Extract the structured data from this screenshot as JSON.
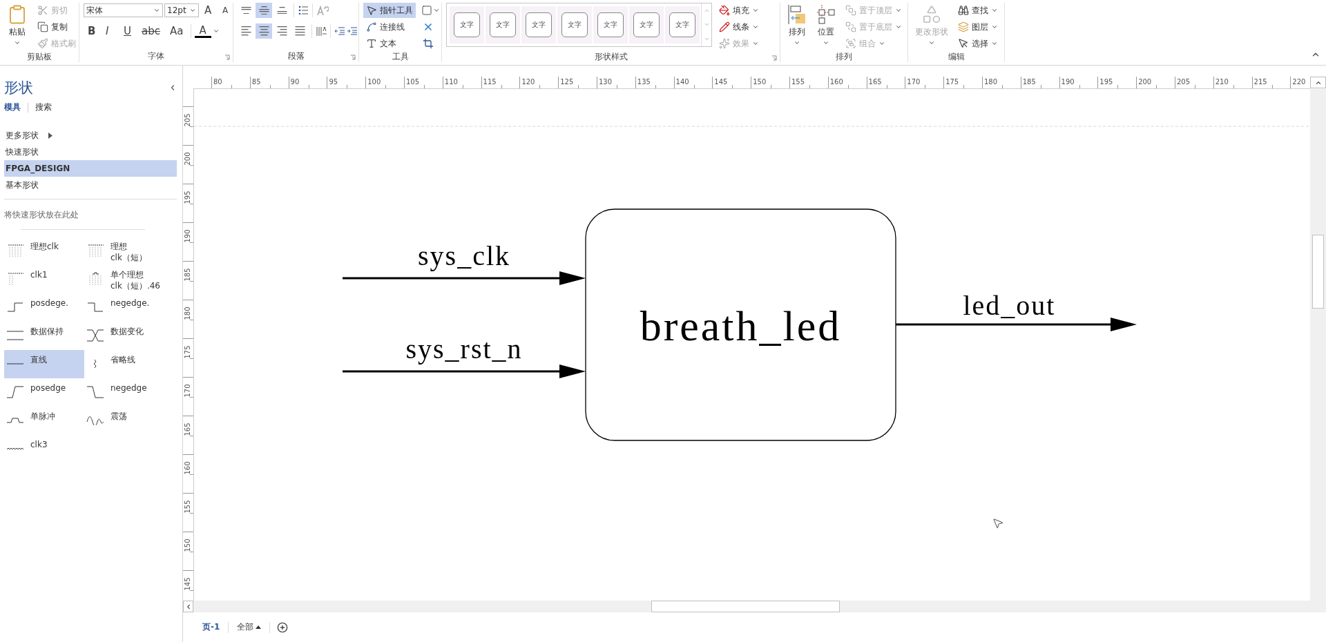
{
  "ribbon": {
    "groups": [
      {
        "kind": "clipboard",
        "label": "剪贴板",
        "paste": {
          "label": "粘贴"
        },
        "actions": [
          {
            "label": "剪切",
            "kind": "cut",
            "disabled": true
          },
          {
            "label": "复制",
            "kind": "copy",
            "disabled": false
          },
          {
            "label": "格式刷",
            "kind": "painter",
            "disabled": true
          }
        ]
      },
      {
        "kind": "font",
        "label": "字体",
        "launcher": true,
        "font_name": "宋体",
        "font_size": "12pt",
        "size_buttons": [
          {
            "text": "A",
            "kind": "grow"
          },
          {
            "text": "A",
            "kind": "shrink"
          }
        ],
        "format_buttons": [
          {
            "text": "B",
            "kind": "bold"
          },
          {
            "text": "I",
            "kind": "italic"
          },
          {
            "text": "U",
            "kind": "underline"
          },
          {
            "text": "abc",
            "kind": "strike"
          },
          {
            "text": "Aa",
            "kind": "case"
          }
        ],
        "font_color": {
          "text": "A"
        }
      },
      {
        "kind": "paragraph",
        "label": "段落",
        "launcher": true,
        "vertical_align": [
          {
            "kind": "top",
            "selected": false
          },
          {
            "kind": "middle",
            "selected": true
          },
          {
            "kind": "bottom",
            "selected": false
          }
        ],
        "horizontal_align": [
          {
            "kind": "left",
            "selected": false
          },
          {
            "kind": "center",
            "selected": true
          },
          {
            "kind": "right",
            "selected": false
          },
          {
            "kind": "justify",
            "selected": false
          }
        ]
      },
      {
        "kind": "tools",
        "label": "工具",
        "tools": [
          {
            "label": "指针工具",
            "kind": "pointer",
            "selected": true
          },
          {
            "label": "连接线",
            "kind": "connector",
            "selected": false
          },
          {
            "label": "文本",
            "kind": "text",
            "selected": false
          }
        ]
      },
      {
        "kind": "styles",
        "label": "形状样式",
        "launcher": true,
        "gallery": [
          "文字",
          "文字",
          "文字",
          "文字",
          "文字",
          "文字",
          "文字"
        ],
        "actions": [
          {
            "label": "填充",
            "kind": "fill",
            "disabled": false
          },
          {
            "label": "线条",
            "kind": "line",
            "disabled": false
          },
          {
            "label": "效果",
            "kind": "effects",
            "disabled": true
          }
        ]
      },
      {
        "kind": "arrange",
        "label": "排列",
        "big": [
          {
            "label": "排列",
            "kind": "arrange"
          },
          {
            "label": "位置",
            "kind": "position"
          }
        ],
        "actions": [
          {
            "label": "置于顶层",
            "kind": "front",
            "disabled": true
          },
          {
            "label": "置于底层",
            "kind": "back",
            "disabled": true
          },
          {
            "label": "组合",
            "kind": "group",
            "disabled": true
          }
        ]
      },
      {
        "kind": "edit",
        "label": "编辑",
        "big": {
          "label": "更改形状",
          "disabled": true
        },
        "actions": [
          {
            "label": "查找",
            "kind": "find",
            "disabled": false
          },
          {
            "label": "图层",
            "kind": "layers",
            "disabled": false
          },
          {
            "label": "选择",
            "kind": "select",
            "disabled": false
          }
        ]
      }
    ]
  },
  "sidebar": {
    "title": "形状",
    "tabs": [
      {
        "label": "模具",
        "selected": true
      },
      {
        "label": "搜索",
        "selected": false
      }
    ],
    "menu": [
      {
        "label": "更多形状",
        "kind": "submenu",
        "selected": false
      },
      {
        "label": "快速形状",
        "kind": "plain",
        "selected": false
      },
      {
        "label": "FPGA_DESIGN",
        "kind": "plain",
        "selected": true
      },
      {
        "label": "基本形状",
        "kind": "plain",
        "selected": false
      }
    ],
    "hint": "将快速形状放在此处",
    "stencils": [
      {
        "label": "理想clk",
        "kind": "clk-ideal",
        "selected": false
      },
      {
        "label": "理想\nclk（短）",
        "kind": "clk-short",
        "selected": false
      },
      {
        "label": "clk1",
        "kind": "clk1",
        "selected": false
      },
      {
        "label": "单个理想\nclk（短）.46",
        "kind": "clk-single",
        "selected": false
      },
      {
        "label": "posdege.",
        "kind": "step-up",
        "selected": false
      },
      {
        "label": "negedge.",
        "kind": "step-down",
        "selected": false
      },
      {
        "label": "数据保持",
        "kind": "hold",
        "selected": false
      },
      {
        "label": "数据变化",
        "kind": "change",
        "selected": false
      },
      {
        "label": "直线",
        "kind": "line",
        "selected": true
      },
      {
        "label": "省略线",
        "kind": "ellipsis",
        "selected": false
      },
      {
        "label": "posedge",
        "kind": "posedge",
        "selected": false
      },
      {
        "label": "negedge",
        "kind": "negedge",
        "selected": false
      },
      {
        "label": "单脉冲",
        "kind": "pulse",
        "selected": false
      },
      {
        "label": "震荡",
        "kind": "oscillate",
        "selected": false
      },
      {
        "label": "clk3",
        "kind": "clk3",
        "selected": false
      }
    ]
  },
  "rulers": {
    "horizontal": [
      "80",
      "85",
      "90",
      "95",
      "100",
      "105",
      "110",
      "115",
      "120",
      "125",
      "130",
      "135",
      "140",
      "145",
      "150",
      "155",
      "160",
      "165",
      "170",
      "175",
      "180",
      "185",
      "190",
      "195",
      "200",
      "205",
      "210",
      "215",
      "220"
    ],
    "vertical": [
      "205",
      "200",
      "195",
      "190",
      "185",
      "180",
      "175",
      "170",
      "165",
      "160",
      "155",
      "150",
      "145"
    ]
  },
  "diagram": {
    "block": {
      "label": "breath_led"
    },
    "inputs": [
      {
        "label": "sys_clk"
      },
      {
        "label": "sys_rst_n"
      }
    ],
    "outputs": [
      {
        "label": "led_out"
      }
    ]
  },
  "page_tabs": [
    {
      "label": "页-1",
      "kind": "page",
      "selected": true
    },
    {
      "label": "全部",
      "kind": "all",
      "selected": false
    }
  ]
}
